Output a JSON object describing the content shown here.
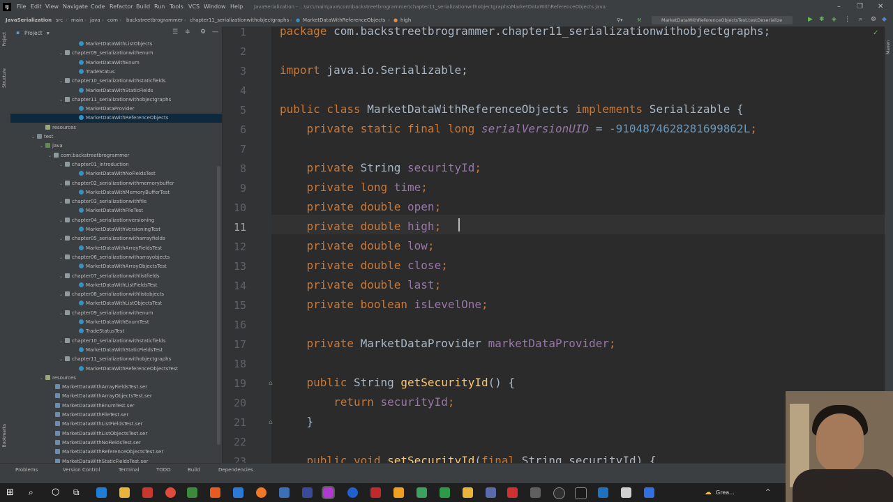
{
  "menu": {
    "items": [
      "File",
      "Edit",
      "View",
      "Navigate",
      "Code",
      "Refactor",
      "Build",
      "Run",
      "Tools",
      "VCS",
      "Window",
      "Help"
    ],
    "window_title": "JavaSerialization - ...\\src\\main\\java\\com\\backstreetbrogrammer\\chapter11_serializationwithobjectgraphs\\MarketDataWithReferenceObjects.java"
  },
  "nav": {
    "crumbs": [
      "JavaSerialization",
      "src",
      "main",
      "java",
      "com",
      "backstreetbrogrammer",
      "chapter11_serializationwithobjectgraphs",
      "MarketDataWithReferenceObjects",
      "high"
    ],
    "run_config": "MarketDataWithReferenceObjectsTest.testDeserialize"
  },
  "left_strip": {
    "project": "Project",
    "structure": "Structure",
    "bookmarks": "Bookmarks"
  },
  "project_panel": {
    "title": "Project",
    "rows": [
      {
        "label": "MarketDataWithListObjects",
        "indent": 100,
        "icon": "cls",
        "arrow": ""
      },
      {
        "label": "chapter09_serializationwithenum",
        "indent": 80,
        "icon": "pkg",
        "arrow": "v"
      },
      {
        "label": "MarketDataWithEnum",
        "indent": 100,
        "icon": "cls",
        "arrow": ""
      },
      {
        "label": "TradeStatus",
        "indent": 100,
        "icon": "cls",
        "arrow": ""
      },
      {
        "label": "chapter10_serializationwithstaticfields",
        "indent": 80,
        "icon": "pkg",
        "arrow": "v"
      },
      {
        "label": "MarketDataWithStaticFields",
        "indent": 100,
        "icon": "cls",
        "arrow": ""
      },
      {
        "label": "chapter11_serializationwithobjectgraphs",
        "indent": 80,
        "icon": "pkg",
        "arrow": "v"
      },
      {
        "label": "MarketDataProvider",
        "indent": 100,
        "icon": "cls",
        "arrow": ""
      },
      {
        "label": "MarketDataWithReferenceObjects",
        "indent": 100,
        "icon": "cls",
        "arrow": "",
        "selected": true
      },
      {
        "label": "resources",
        "indent": 52,
        "icon": "res",
        "arrow": ""
      },
      {
        "label": "test",
        "indent": 40,
        "icon": "folder",
        "arrow": "v"
      },
      {
        "label": "java",
        "indent": 52,
        "icon": "javafolder",
        "arrow": "v"
      },
      {
        "label": "com.backstreetbrogrammer",
        "indent": 64,
        "icon": "pkg",
        "arrow": "v"
      },
      {
        "label": "chapter01_introduction",
        "indent": 80,
        "icon": "pkg",
        "arrow": "v"
      },
      {
        "label": "MarketDataWithNoFieldsTest",
        "indent": 100,
        "icon": "cls",
        "arrow": ""
      },
      {
        "label": "chapter02_serializationwithmemorybuffer",
        "indent": 80,
        "icon": "pkg",
        "arrow": "v"
      },
      {
        "label": "MarketDataWithMemoryBufferTest",
        "indent": 100,
        "icon": "cls",
        "arrow": ""
      },
      {
        "label": "chapter03_serializationwithfile",
        "indent": 80,
        "icon": "pkg",
        "arrow": "v"
      },
      {
        "label": "MarketDataWithFileTest",
        "indent": 100,
        "icon": "cls",
        "arrow": ""
      },
      {
        "label": "chapter04_serializationversioning",
        "indent": 80,
        "icon": "pkg",
        "arrow": "v"
      },
      {
        "label": "MarketDataWithVersioningTest",
        "indent": 100,
        "icon": "cls",
        "arrow": ""
      },
      {
        "label": "chapter05_serializationwitharrayfields",
        "indent": 80,
        "icon": "pkg",
        "arrow": "v"
      },
      {
        "label": "MarketDataWithArrayFieldsTest",
        "indent": 100,
        "icon": "cls",
        "arrow": ""
      },
      {
        "label": "chapter06_serializationwitharrayobjects",
        "indent": 80,
        "icon": "pkg",
        "arrow": "v"
      },
      {
        "label": "MarketDataWithArrayObjectsTest",
        "indent": 100,
        "icon": "cls",
        "arrow": ""
      },
      {
        "label": "chapter07_serializationwithlistfields",
        "indent": 80,
        "icon": "pkg",
        "arrow": "v"
      },
      {
        "label": "MarketDataWithListFieldsTest",
        "indent": 100,
        "icon": "cls",
        "arrow": ""
      },
      {
        "label": "chapter08_serializationwithlistobjects",
        "indent": 80,
        "icon": "pkg",
        "arrow": "v"
      },
      {
        "label": "MarketDataWithListObjectsTest",
        "indent": 100,
        "icon": "cls",
        "arrow": ""
      },
      {
        "label": "chapter09_serializationwithenum",
        "indent": 80,
        "icon": "pkg",
        "arrow": "v"
      },
      {
        "label": "MarketDataWithEnumTest",
        "indent": 100,
        "icon": "cls",
        "arrow": ""
      },
      {
        "label": "TradeStatusTest",
        "indent": 100,
        "icon": "cls",
        "arrow": ""
      },
      {
        "label": "chapter10_serializationwithstaticfields",
        "indent": 80,
        "icon": "pkg",
        "arrow": "v"
      },
      {
        "label": "MarketDataWithStaticFieldsTest",
        "indent": 100,
        "icon": "cls",
        "arrow": ""
      },
      {
        "label": "chapter11_serializationwithobjectgraphs",
        "indent": 80,
        "icon": "pkg",
        "arrow": "v"
      },
      {
        "label": "MarketDataWithReferenceObjectsTest",
        "indent": 100,
        "icon": "cls",
        "arrow": ""
      },
      {
        "label": "resources",
        "indent": 52,
        "icon": "res",
        "arrow": "v"
      },
      {
        "label": "MarketDataWithArrayFieldsTest.ser",
        "indent": 66,
        "icon": "file",
        "arrow": ""
      },
      {
        "label": "MarketDataWithArrayObjectsTest.ser",
        "indent": 66,
        "icon": "file",
        "arrow": ""
      },
      {
        "label": "MarketDataWithEnumTest.ser",
        "indent": 66,
        "icon": "file",
        "arrow": ""
      },
      {
        "label": "MarketDataWithFileTest.ser",
        "indent": 66,
        "icon": "file",
        "arrow": ""
      },
      {
        "label": "MarketDataWithListFieldsTest.ser",
        "indent": 66,
        "icon": "file",
        "arrow": ""
      },
      {
        "label": "MarketDataWithListObjectsTest.ser",
        "indent": 66,
        "icon": "file",
        "arrow": ""
      },
      {
        "label": "MarketDataWithNoFieldsTest.ser",
        "indent": 66,
        "icon": "file",
        "arrow": ""
      },
      {
        "label": "MarketDataWithReferenceObjectsTest.ser",
        "indent": 66,
        "icon": "file",
        "arrow": ""
      },
      {
        "label": "MarketDataWithStaticFieldsTest.ser",
        "indent": 66,
        "icon": "file",
        "arrow": ""
      }
    ]
  },
  "editor": {
    "current_line": 11,
    "lines": [
      {
        "n": "1",
        "tokens": [
          [
            "kw",
            "package"
          ],
          [
            "t",
            " com.backstreetbrogrammer.chapter11_serializationwithobjectgraphs;"
          ]
        ]
      },
      {
        "n": "2",
        "tokens": []
      },
      {
        "n": "3",
        "tokens": [
          [
            "kw",
            "import"
          ],
          [
            "t",
            " java.io.Serializable;"
          ]
        ]
      },
      {
        "n": "4",
        "tokens": []
      },
      {
        "n": "5",
        "tokens": [
          [
            "kw",
            "public class"
          ],
          [
            "t",
            " MarketDataWithReferenceObjects "
          ],
          [
            "kw",
            "implements"
          ],
          [
            "t",
            " Serializable {"
          ]
        ]
      },
      {
        "n": "6",
        "tokens": [
          [
            "t",
            "    "
          ],
          [
            "kw",
            "private static final long"
          ],
          [
            "t",
            " "
          ],
          [
            "sfld",
            "serialVersionUID"
          ],
          [
            "t",
            " = "
          ],
          [
            "num",
            "-9104874628281699862L"
          ],
          [
            "kw",
            ";"
          ]
        ]
      },
      {
        "n": "7",
        "tokens": []
      },
      {
        "n": "8",
        "tokens": [
          [
            "t",
            "    "
          ],
          [
            "kw",
            "private"
          ],
          [
            "t",
            " String "
          ],
          [
            "fld",
            "securityId"
          ],
          [
            "kw",
            ";"
          ]
        ]
      },
      {
        "n": "9",
        "tokens": [
          [
            "t",
            "    "
          ],
          [
            "kw",
            "private long"
          ],
          [
            "t",
            " "
          ],
          [
            "fld",
            "time"
          ],
          [
            "kw",
            ";"
          ]
        ]
      },
      {
        "n": "10",
        "tokens": [
          [
            "t",
            "    "
          ],
          [
            "kw",
            "private double"
          ],
          [
            "t",
            " "
          ],
          [
            "fld",
            "open"
          ],
          [
            "kw",
            ";"
          ]
        ]
      },
      {
        "n": "11",
        "tokens": [
          [
            "t",
            "    "
          ],
          [
            "kw",
            "private double"
          ],
          [
            "t",
            " "
          ],
          [
            "fld",
            "high"
          ],
          [
            "kw",
            ";"
          ]
        ]
      },
      {
        "n": "12",
        "tokens": [
          [
            "t",
            "    "
          ],
          [
            "kw",
            "private double"
          ],
          [
            "t",
            " "
          ],
          [
            "fld",
            "low"
          ],
          [
            "kw",
            ";"
          ]
        ]
      },
      {
        "n": "13",
        "tokens": [
          [
            "t",
            "    "
          ],
          [
            "kw",
            "private double"
          ],
          [
            "t",
            " "
          ],
          [
            "fld",
            "close"
          ],
          [
            "kw",
            ";"
          ]
        ]
      },
      {
        "n": "14",
        "tokens": [
          [
            "t",
            "    "
          ],
          [
            "kw",
            "private double"
          ],
          [
            "t",
            " "
          ],
          [
            "fld",
            "last"
          ],
          [
            "kw",
            ";"
          ]
        ]
      },
      {
        "n": "15",
        "tokens": [
          [
            "t",
            "    "
          ],
          [
            "kw",
            "private boolean"
          ],
          [
            "t",
            " "
          ],
          [
            "fld",
            "isLevelOne"
          ],
          [
            "kw",
            ";"
          ]
        ]
      },
      {
        "n": "16",
        "tokens": []
      },
      {
        "n": "17",
        "tokens": [
          [
            "t",
            "    "
          ],
          [
            "kw",
            "private"
          ],
          [
            "t",
            " MarketDataProvider "
          ],
          [
            "fld",
            "marketDataProvider"
          ],
          [
            "kw",
            ";"
          ]
        ]
      },
      {
        "n": "18",
        "tokens": []
      },
      {
        "n": "19",
        "tokens": [
          [
            "t",
            "    "
          ],
          [
            "kw",
            "public"
          ],
          [
            "t",
            " String "
          ],
          [
            "mth",
            "getSecurityId"
          ],
          [
            "t",
            "() {"
          ]
        ]
      },
      {
        "n": "20",
        "tokens": [
          [
            "t",
            "        "
          ],
          [
            "kw",
            "return"
          ],
          [
            "t",
            " "
          ],
          [
            "fld",
            "securityId"
          ],
          [
            "kw",
            ";"
          ]
        ]
      },
      {
        "n": "21",
        "tokens": [
          [
            "t",
            "    }"
          ]
        ]
      },
      {
        "n": "22",
        "tokens": []
      },
      {
        "n": "23",
        "tokens": [
          [
            "t",
            "    "
          ],
          [
            "kw",
            "public void"
          ],
          [
            "t",
            " "
          ],
          [
            "mth",
            "setSecurityId"
          ],
          [
            "t",
            "("
          ],
          [
            "kw",
            "final"
          ],
          [
            "t",
            " String securityId) {"
          ]
        ]
      }
    ]
  },
  "bottom_tabs": [
    "Problems",
    "Version Control",
    "Terminal",
    "TODO",
    "Dependencies",
    "Build"
  ],
  "taskbar": {
    "weather_text": "Grea..."
  },
  "colors": {
    "accent_keyword": "#cc7832",
    "field": "#9876aa",
    "number": "#6897bb",
    "method": "#ffc66d",
    "text": "#a9b7c6"
  }
}
